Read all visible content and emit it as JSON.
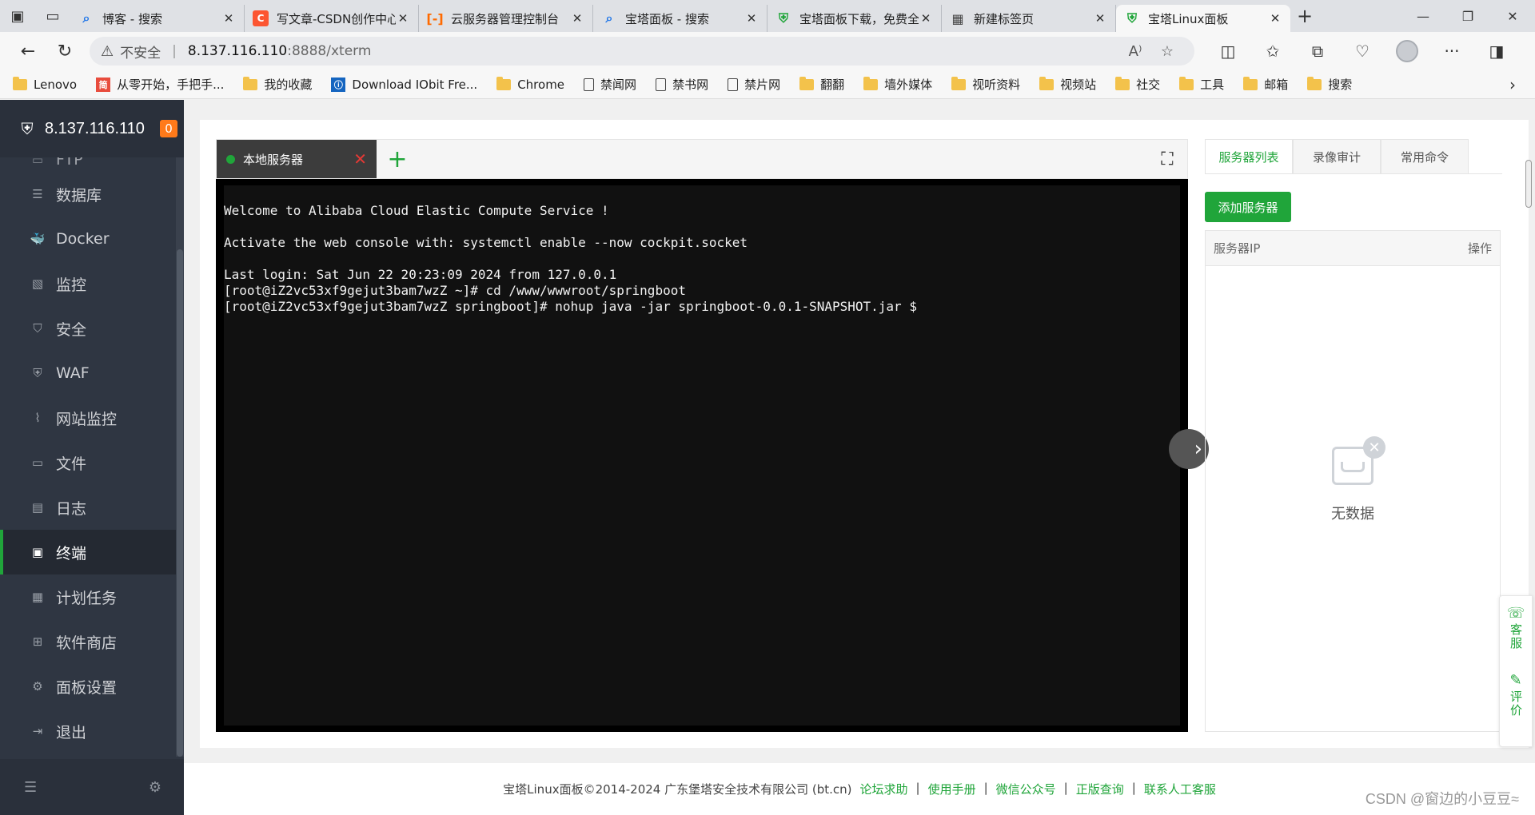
{
  "browser": {
    "tabs": [
      {
        "title": "博客 - 搜索",
        "icon": "search-icon",
        "color": "#1a73e8",
        "active": false
      },
      {
        "title": "写文章-CSDN创作中心",
        "icon": "csdn-icon",
        "color": "#fc5531",
        "active": false
      },
      {
        "title": "云服务器管理控制台",
        "icon": "aliyun-icon",
        "color": "#ff6a00",
        "active": false
      },
      {
        "title": "宝塔面板 - 搜索",
        "icon": "search-icon",
        "color": "#1a73e8",
        "active": false
      },
      {
        "title": "宝塔面板下载，免费全能的服务器",
        "icon": "bt-shield-icon",
        "color": "#20a53a",
        "active": false
      },
      {
        "title": "新建标签页",
        "icon": "newtab-icon",
        "color": "#444444",
        "active": false
      },
      {
        "title": "宝塔Linux面板",
        "icon": "bt-shield-icon",
        "color": "#20a53a",
        "active": true
      }
    ],
    "address": {
      "security_label": "不安全",
      "host": "8.137.116.110",
      "path": ":8888/xterm"
    },
    "bookmarks": [
      {
        "label": "Lenovo",
        "icon": "folder-icon"
      },
      {
        "label": "从零开始，手把手...",
        "icon": "csdn-icon"
      },
      {
        "label": "我的收藏",
        "icon": "folder-icon"
      },
      {
        "label": "Download IObit Fre...",
        "icon": "iobit-icon"
      },
      {
        "label": "Chrome",
        "icon": "folder-icon"
      },
      {
        "label": "禁闻网",
        "icon": "page-icon"
      },
      {
        "label": "禁书网",
        "icon": "page-icon"
      },
      {
        "label": "禁片网",
        "icon": "page-icon"
      },
      {
        "label": "翻翻",
        "icon": "folder-icon"
      },
      {
        "label": "墙外媒体",
        "icon": "folder-icon"
      },
      {
        "label": "视听资料",
        "icon": "folder-icon"
      },
      {
        "label": "视频站",
        "icon": "folder-icon"
      },
      {
        "label": "社交",
        "icon": "folder-icon"
      },
      {
        "label": "工具",
        "icon": "folder-icon"
      },
      {
        "label": "邮箱",
        "icon": "folder-icon"
      },
      {
        "label": "搜索",
        "icon": "folder-icon"
      }
    ]
  },
  "sidebar": {
    "server_ip": "8.137.116.110",
    "badge": "0",
    "partial_item": "FTP",
    "items": [
      {
        "label": "数据库",
        "icon": "database-icon",
        "active": false
      },
      {
        "label": "Docker",
        "icon": "docker-icon",
        "active": false
      },
      {
        "label": "监控",
        "icon": "monitor-icon",
        "active": false
      },
      {
        "label": "安全",
        "icon": "shield-icon",
        "active": false
      },
      {
        "label": "WAF",
        "icon": "waf-shield-icon",
        "active": false
      },
      {
        "label": "网站监控",
        "icon": "chart-line-icon",
        "active": false
      },
      {
        "label": "文件",
        "icon": "folder-icon",
        "active": false
      },
      {
        "label": "日志",
        "icon": "log-icon",
        "active": false
      },
      {
        "label": "终端",
        "icon": "terminal-icon",
        "active": true
      },
      {
        "label": "计划任务",
        "icon": "calendar-icon",
        "active": false
      },
      {
        "label": "软件商店",
        "icon": "apps-icon",
        "active": false
      },
      {
        "label": "面板设置",
        "icon": "gear-icon",
        "active": false
      },
      {
        "label": "退出",
        "icon": "logout-icon",
        "active": false
      }
    ]
  },
  "terminal": {
    "tab_label": "本地服务器",
    "lines": [
      "Welcome to Alibaba Cloud Elastic Compute Service !",
      "",
      "Activate the web console with: systemctl enable --now cockpit.socket",
      "",
      "Last login: Sat Jun 22 20:23:09 2024 from 127.0.0.1",
      "[root@iZ2vc53xf9gejut3bam7wzZ ~]# cd /www/wwwroot/springboot",
      "[root@iZ2vc53xf9gejut3bam7wzZ springboot]# nohup java -jar springboot-0.0.1-SNAPSHOT.jar $"
    ]
  },
  "right_panel": {
    "tabs": [
      "服务器列表",
      "录像审计",
      "常用命令"
    ],
    "add_button": "添加服务器",
    "table_headers": {
      "ip": "服务器IP",
      "action": "操作"
    },
    "empty_text": "无数据"
  },
  "service_widget": {
    "service_label": "客服",
    "review_label": "评价"
  },
  "footer": {
    "copyright": "宝塔Linux面板©2014-2024 广东堡塔安全技术有限公司 (bt.cn)",
    "links": [
      "论坛求助",
      "使用手册",
      "微信公众号",
      "正版查询",
      "联系人工客服"
    ]
  },
  "watermark": "CSDN @窗边的小豆豆≈",
  "colors": {
    "accent": "#20a53a",
    "sidebar_bg": "#2f3642",
    "badge": "#ff7a1a"
  }
}
